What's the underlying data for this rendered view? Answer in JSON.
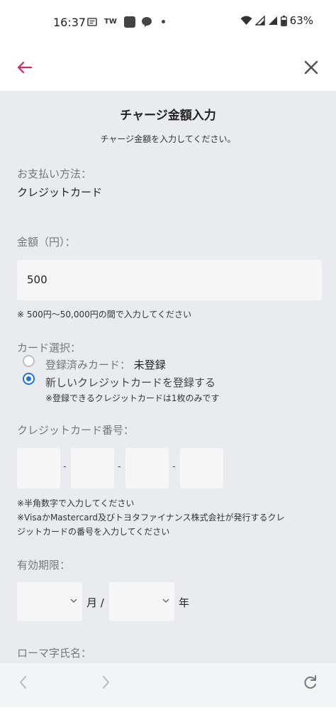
{
  "status_bar": {
    "time": "16:37",
    "notif_tw": "TW",
    "battery": "63%",
    "icons": [
      "message-icon",
      "tw-icon",
      "app-icon",
      "line-icon",
      "dot-icon",
      "wifi-icon",
      "signal-icon",
      "battery-icon"
    ]
  },
  "app_bar": {
    "back_icon": "arrow-left-icon",
    "close_icon": "close-icon",
    "accent_color": "#e0245e"
  },
  "page": {
    "title": "チャージ金額入力",
    "subtitle": "チャージ金額を入力してください。"
  },
  "payment": {
    "label": "お支払い方法：",
    "value": "クレジットカード"
  },
  "amount": {
    "label": "金額（円）：",
    "value": "500",
    "note": "※ 500円〜50,000円の間で入力してください"
  },
  "card_select": {
    "label": "カード選択：",
    "options": [
      {
        "label": "登録済みカード：",
        "status": "未登録",
        "checked": false
      },
      {
        "label": "新しいクレジットカードを登録する",
        "checked": true
      }
    ],
    "note": "※登録できるクレジットカードは1枚のみです"
  },
  "card_number": {
    "label": "クレジットカード番号：",
    "fields": [
      "",
      "",
      "",
      ""
    ],
    "separator": "-",
    "notes": [
      "※半角数字で入力してください",
      "※VisaかMastercard及びトヨタファイナンス株式会社が発行するクレ",
      "ジットカードの番号を入力してください"
    ]
  },
  "expiry": {
    "label": "有効期限：",
    "month_value": "",
    "month_suffix": "月 /",
    "year_value": "",
    "year_suffix": "年"
  },
  "name": {
    "label": "ローマ字氏名："
  },
  "bottom_nav": {
    "icons": [
      "chevron-left-icon",
      "chevron-right-icon",
      "refresh-icon"
    ]
  }
}
